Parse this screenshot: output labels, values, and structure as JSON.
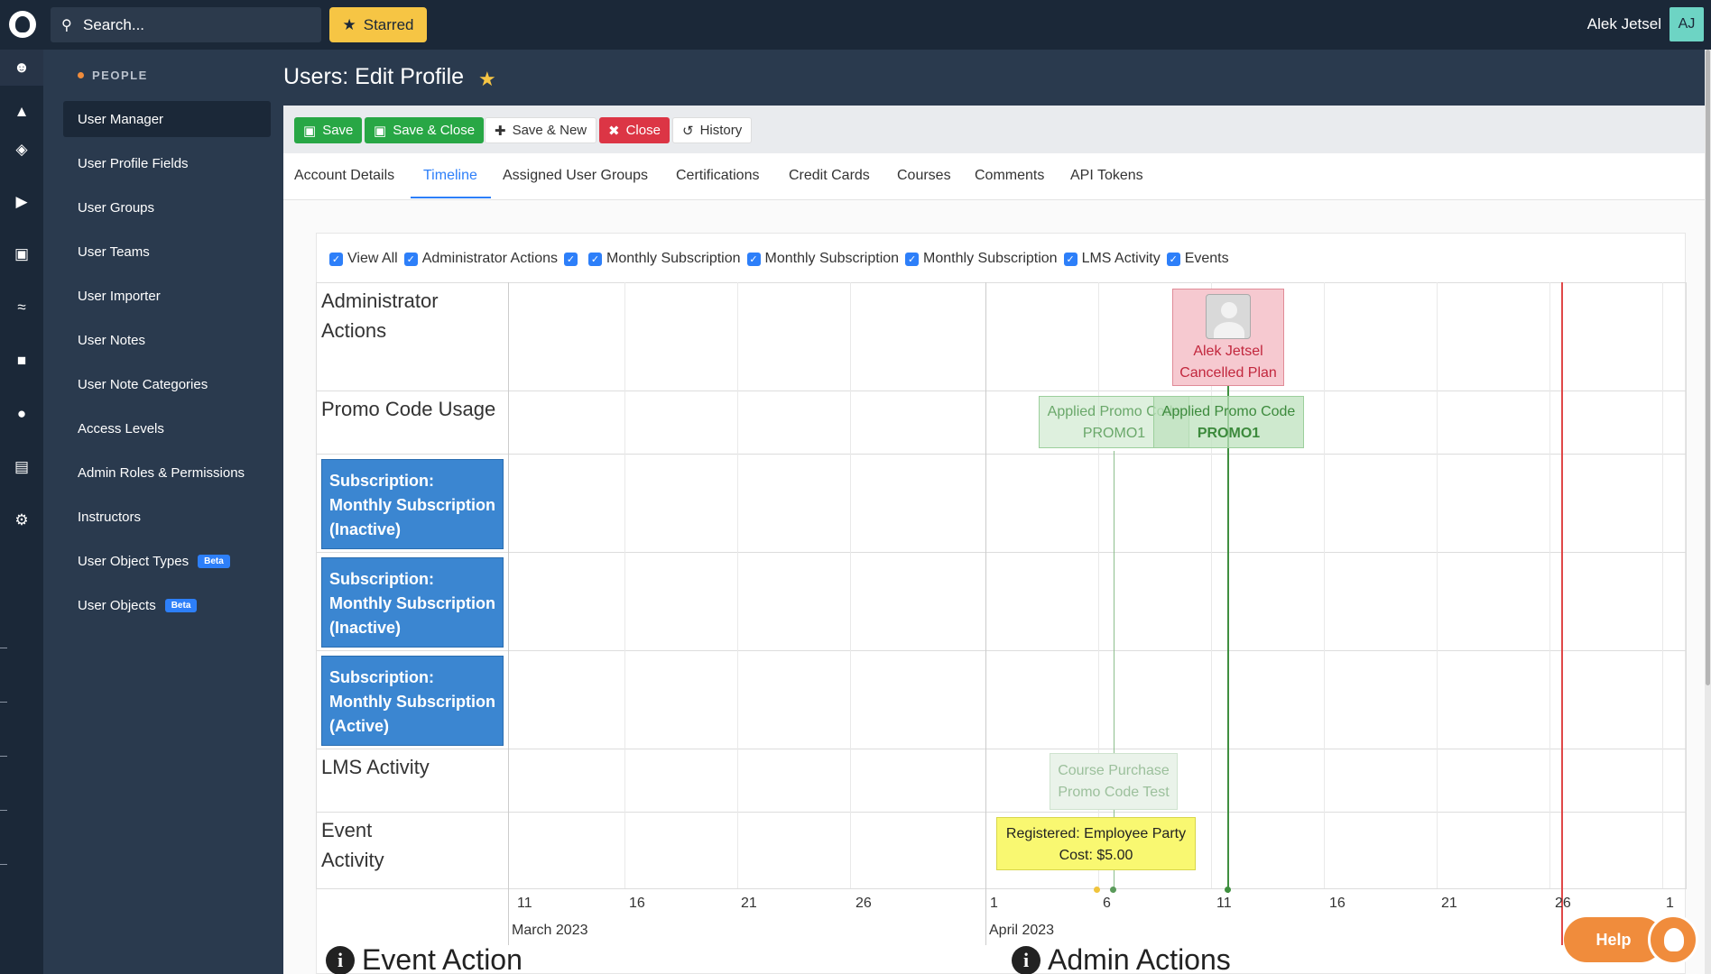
{
  "topbar": {
    "search_placeholder": "Search...",
    "starred_label": "Starred",
    "user_name": "Alek Jetsel",
    "user_initials": "AJ"
  },
  "rail_icons": [
    "people-icon",
    "shapes-icon",
    "graduation-cap-icon",
    "megaphone-icon",
    "money-icon",
    "chart-icon",
    "chat-icon",
    "palette-icon",
    "window-icon",
    "gear-icon"
  ],
  "sidebar": {
    "heading": "PEOPLE",
    "items": [
      {
        "label": "User Manager"
      },
      {
        "label": "User Profile Fields"
      },
      {
        "label": "User Groups"
      },
      {
        "label": "User Teams"
      },
      {
        "label": "User Importer"
      },
      {
        "label": "User Notes"
      },
      {
        "label": "User Note Categories"
      },
      {
        "label": "Access Levels"
      },
      {
        "label": "Admin Roles & Permissions"
      },
      {
        "label": "Instructors"
      },
      {
        "label": "User Object Types",
        "badge": "Beta"
      },
      {
        "label": "User Objects",
        "badge": "Beta"
      }
    ]
  },
  "page": {
    "title": "Users: Edit Profile"
  },
  "toolbar": {
    "save": "Save",
    "save_close": "Save & Close",
    "save_new": "Save & New",
    "close": "Close",
    "history": "History"
  },
  "tabs": [
    "Account Details",
    "Timeline",
    "Assigned User Groups",
    "Certifications",
    "Credit Cards",
    "Courses",
    "Comments",
    "API Tokens"
  ],
  "active_tab": "Timeline",
  "filters": [
    "View All",
    "Administrator Actions",
    "",
    "Monthly Subscription",
    "Monthly Subscription",
    "Monthly Subscription",
    "LMS Activity",
    "Events"
  ],
  "timeline": {
    "rows": {
      "admin": "Administrator Actions",
      "promo": "Promo Code Usage",
      "sub1": "Subscription: Monthly Subscription (Inactive)",
      "sub2": "Subscription: Monthly Subscription (Inactive)",
      "sub3": "Subscription: Monthly Subscription (Active)",
      "lms": "LMS Activity",
      "event": "Event Activity"
    },
    "admin_card": {
      "name": "Alek Jetsel",
      "action": "Cancelled Plan"
    },
    "promo_cards": [
      {
        "line1": "Applied Promo Code",
        "line2": "PROMO1"
      },
      {
        "line1": "Applied Promo Code",
        "line2": "PROMO1"
      }
    ],
    "lms_card": {
      "line1": "Course Purchase",
      "line2": "Promo Code Test"
    },
    "event_card": {
      "line1": "Registered: Employee Party",
      "line2": "Cost: $5.00"
    },
    "ticks": [
      "11",
      "16",
      "21",
      "26",
      "1",
      "6",
      "11",
      "16",
      "21",
      "26",
      "1"
    ],
    "months": [
      "March 2023",
      "April 2023"
    ]
  },
  "sections": {
    "event_action": "Event Action",
    "admin_actions": "Admin Actions"
  },
  "help": {
    "label": "Help"
  },
  "colors": {
    "navy": "#1b2838",
    "accent_blue": "#2d7ff9",
    "green": "#28a745",
    "red": "#dc3545",
    "star": "#f6c544",
    "orange": "#f08c3c"
  }
}
